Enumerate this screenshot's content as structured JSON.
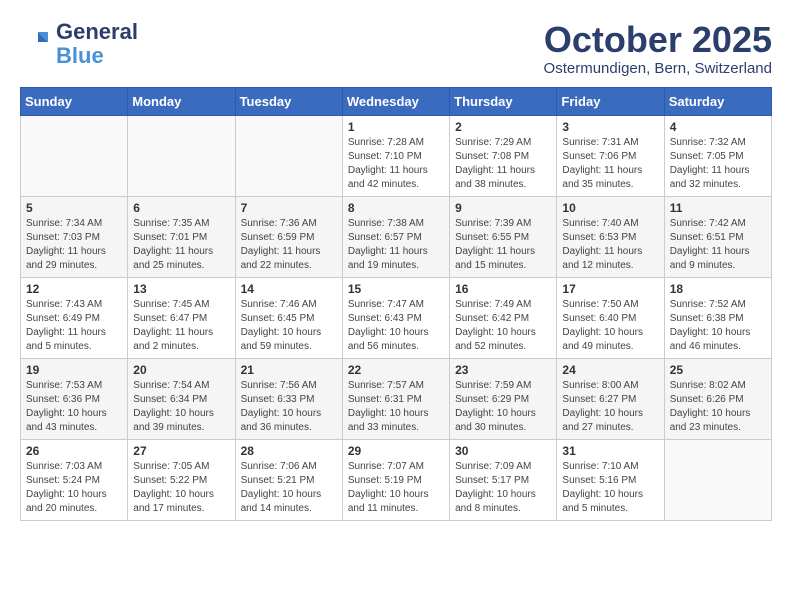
{
  "header": {
    "logo_general": "General",
    "logo_blue": "Blue",
    "month_title": "October 2025",
    "location": "Ostermundigen, Bern, Switzerland"
  },
  "days_of_week": [
    "Sunday",
    "Monday",
    "Tuesday",
    "Wednesday",
    "Thursday",
    "Friday",
    "Saturday"
  ],
  "weeks": [
    [
      {
        "day": "",
        "info": ""
      },
      {
        "day": "",
        "info": ""
      },
      {
        "day": "",
        "info": ""
      },
      {
        "day": "1",
        "info": "Sunrise: 7:28 AM\nSunset: 7:10 PM\nDaylight: 11 hours\nand 42 minutes."
      },
      {
        "day": "2",
        "info": "Sunrise: 7:29 AM\nSunset: 7:08 PM\nDaylight: 11 hours\nand 38 minutes."
      },
      {
        "day": "3",
        "info": "Sunrise: 7:31 AM\nSunset: 7:06 PM\nDaylight: 11 hours\nand 35 minutes."
      },
      {
        "day": "4",
        "info": "Sunrise: 7:32 AM\nSunset: 7:05 PM\nDaylight: 11 hours\nand 32 minutes."
      }
    ],
    [
      {
        "day": "5",
        "info": "Sunrise: 7:34 AM\nSunset: 7:03 PM\nDaylight: 11 hours\nand 29 minutes."
      },
      {
        "day": "6",
        "info": "Sunrise: 7:35 AM\nSunset: 7:01 PM\nDaylight: 11 hours\nand 25 minutes."
      },
      {
        "day": "7",
        "info": "Sunrise: 7:36 AM\nSunset: 6:59 PM\nDaylight: 11 hours\nand 22 minutes."
      },
      {
        "day": "8",
        "info": "Sunrise: 7:38 AM\nSunset: 6:57 PM\nDaylight: 11 hours\nand 19 minutes."
      },
      {
        "day": "9",
        "info": "Sunrise: 7:39 AM\nSunset: 6:55 PM\nDaylight: 11 hours\nand 15 minutes."
      },
      {
        "day": "10",
        "info": "Sunrise: 7:40 AM\nSunset: 6:53 PM\nDaylight: 11 hours\nand 12 minutes."
      },
      {
        "day": "11",
        "info": "Sunrise: 7:42 AM\nSunset: 6:51 PM\nDaylight: 11 hours\nand 9 minutes."
      }
    ],
    [
      {
        "day": "12",
        "info": "Sunrise: 7:43 AM\nSunset: 6:49 PM\nDaylight: 11 hours\nand 5 minutes."
      },
      {
        "day": "13",
        "info": "Sunrise: 7:45 AM\nSunset: 6:47 PM\nDaylight: 11 hours\nand 2 minutes."
      },
      {
        "day": "14",
        "info": "Sunrise: 7:46 AM\nSunset: 6:45 PM\nDaylight: 10 hours\nand 59 minutes."
      },
      {
        "day": "15",
        "info": "Sunrise: 7:47 AM\nSunset: 6:43 PM\nDaylight: 10 hours\nand 56 minutes."
      },
      {
        "day": "16",
        "info": "Sunrise: 7:49 AM\nSunset: 6:42 PM\nDaylight: 10 hours\nand 52 minutes."
      },
      {
        "day": "17",
        "info": "Sunrise: 7:50 AM\nSunset: 6:40 PM\nDaylight: 10 hours\nand 49 minutes."
      },
      {
        "day": "18",
        "info": "Sunrise: 7:52 AM\nSunset: 6:38 PM\nDaylight: 10 hours\nand 46 minutes."
      }
    ],
    [
      {
        "day": "19",
        "info": "Sunrise: 7:53 AM\nSunset: 6:36 PM\nDaylight: 10 hours\nand 43 minutes."
      },
      {
        "day": "20",
        "info": "Sunrise: 7:54 AM\nSunset: 6:34 PM\nDaylight: 10 hours\nand 39 minutes."
      },
      {
        "day": "21",
        "info": "Sunrise: 7:56 AM\nSunset: 6:33 PM\nDaylight: 10 hours\nand 36 minutes."
      },
      {
        "day": "22",
        "info": "Sunrise: 7:57 AM\nSunset: 6:31 PM\nDaylight: 10 hours\nand 33 minutes."
      },
      {
        "day": "23",
        "info": "Sunrise: 7:59 AM\nSunset: 6:29 PM\nDaylight: 10 hours\nand 30 minutes."
      },
      {
        "day": "24",
        "info": "Sunrise: 8:00 AM\nSunset: 6:27 PM\nDaylight: 10 hours\nand 27 minutes."
      },
      {
        "day": "25",
        "info": "Sunrise: 8:02 AM\nSunset: 6:26 PM\nDaylight: 10 hours\nand 23 minutes."
      }
    ],
    [
      {
        "day": "26",
        "info": "Sunrise: 7:03 AM\nSunset: 5:24 PM\nDaylight: 10 hours\nand 20 minutes."
      },
      {
        "day": "27",
        "info": "Sunrise: 7:05 AM\nSunset: 5:22 PM\nDaylight: 10 hours\nand 17 minutes."
      },
      {
        "day": "28",
        "info": "Sunrise: 7:06 AM\nSunset: 5:21 PM\nDaylight: 10 hours\nand 14 minutes."
      },
      {
        "day": "29",
        "info": "Sunrise: 7:07 AM\nSunset: 5:19 PM\nDaylight: 10 hours\nand 11 minutes."
      },
      {
        "day": "30",
        "info": "Sunrise: 7:09 AM\nSunset: 5:17 PM\nDaylight: 10 hours\nand 8 minutes."
      },
      {
        "day": "31",
        "info": "Sunrise: 7:10 AM\nSunset: 5:16 PM\nDaylight: 10 hours\nand 5 minutes."
      },
      {
        "day": "",
        "info": ""
      }
    ]
  ]
}
